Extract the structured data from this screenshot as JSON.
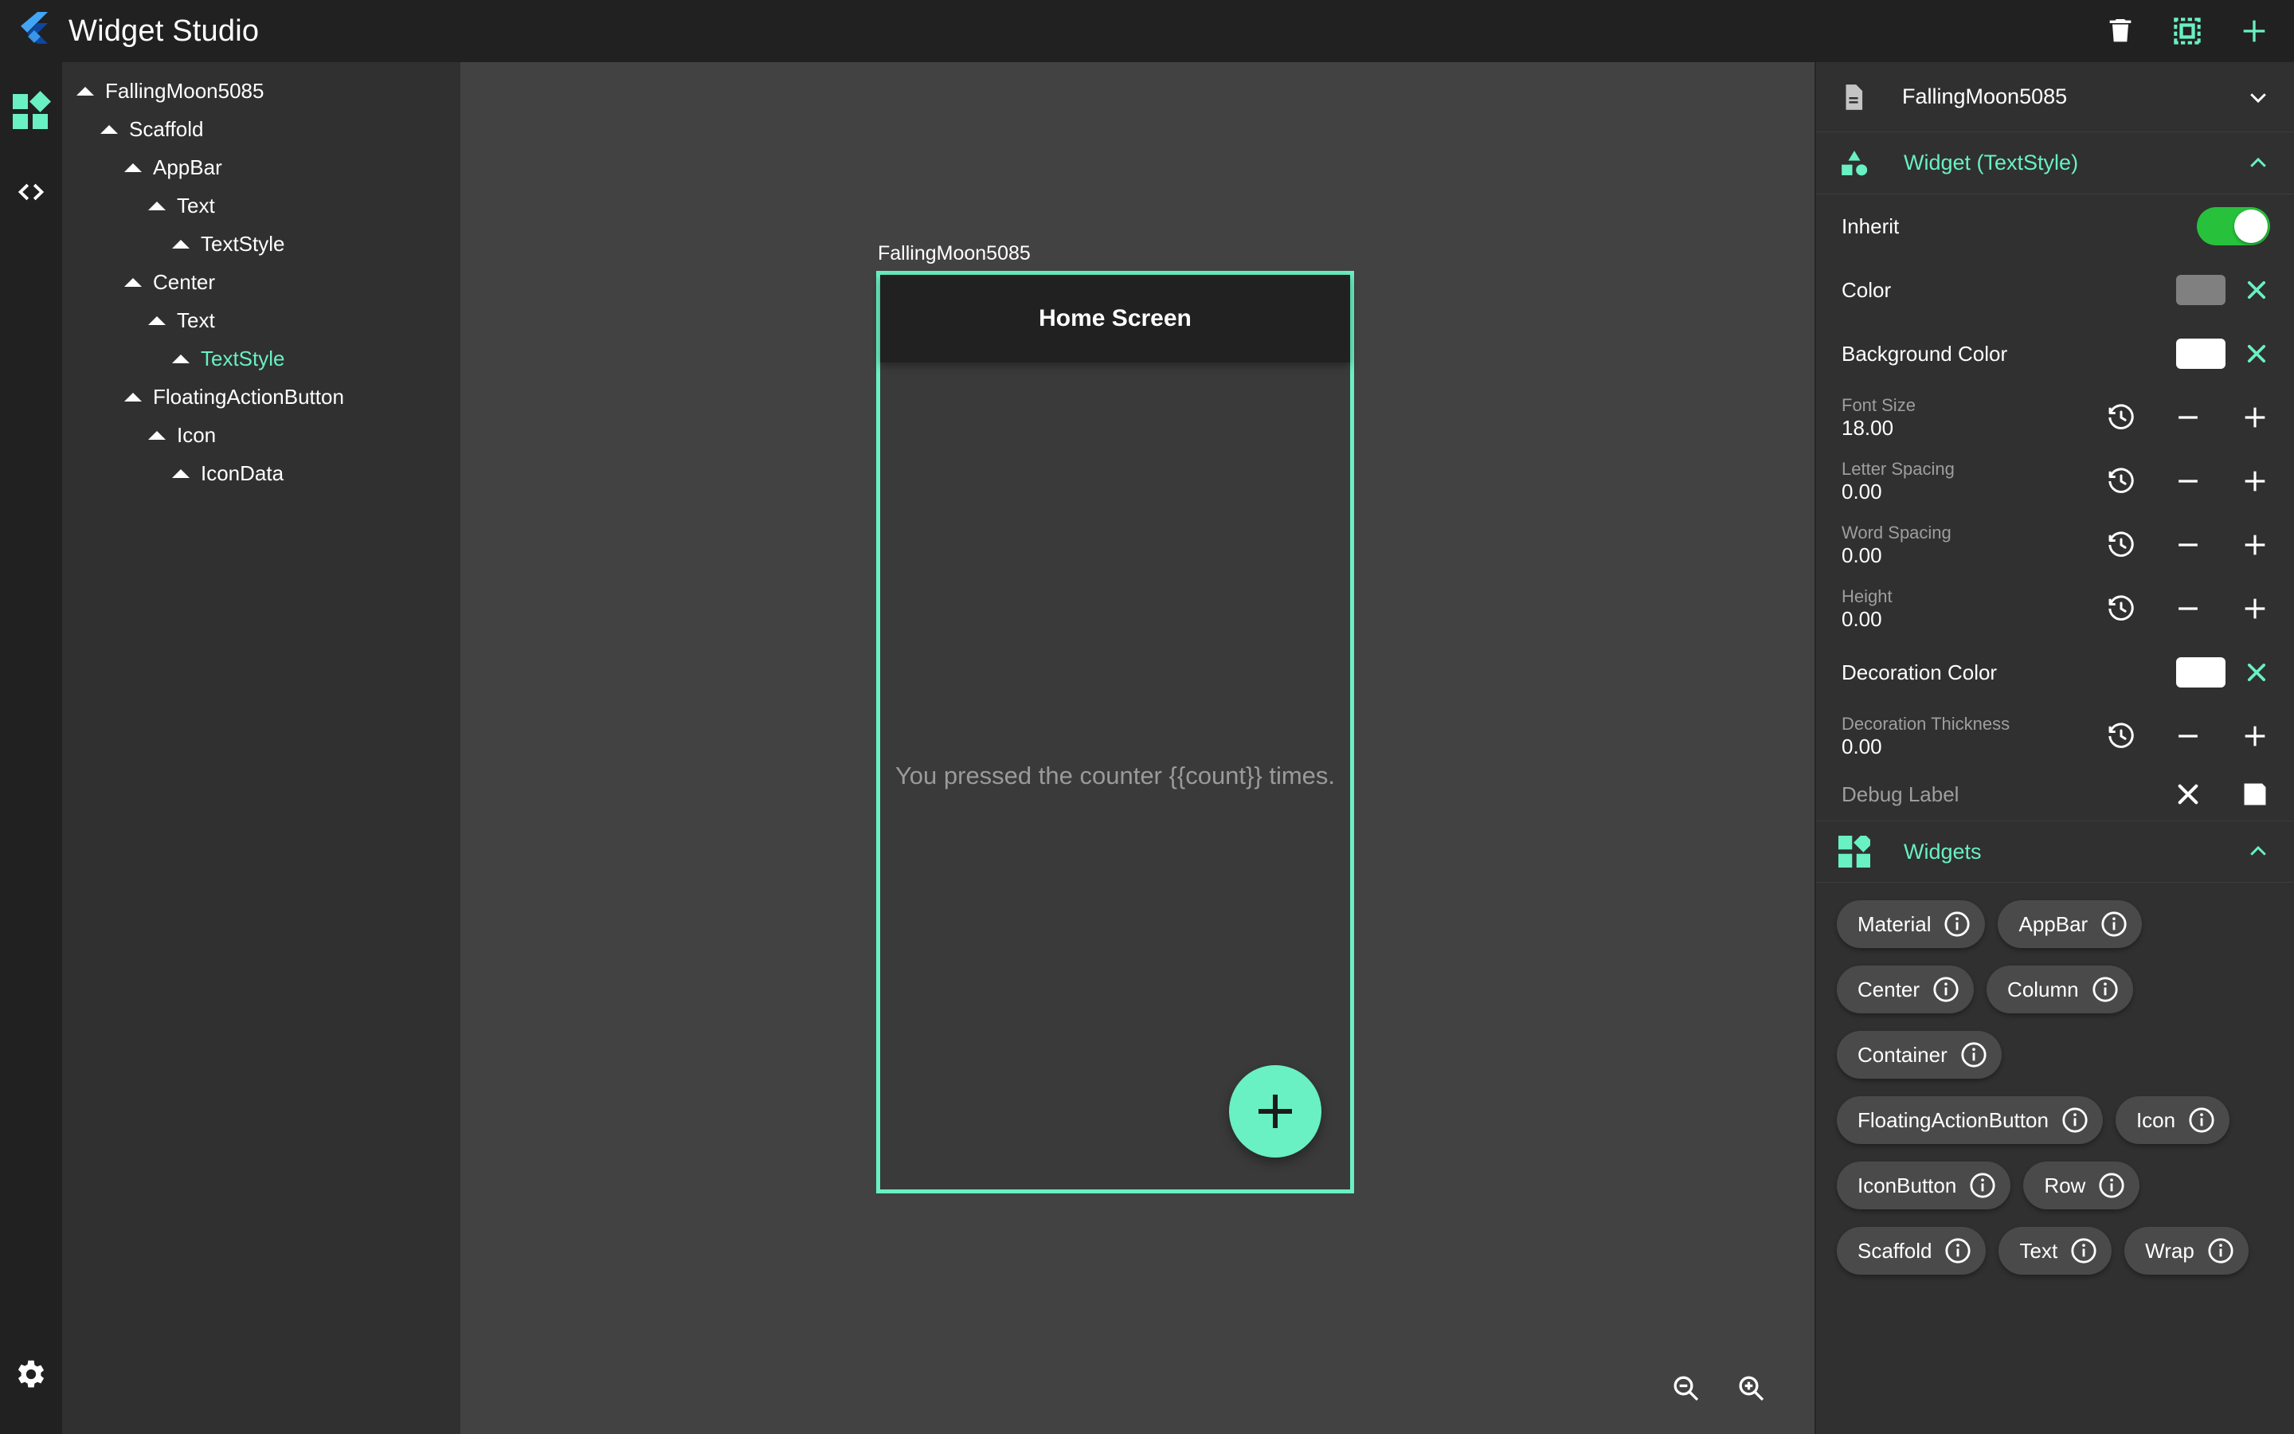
{
  "app": {
    "title": "Widget Studio",
    "logo_icon": "flutter-logo"
  },
  "titlebar_actions": [
    {
      "name": "delete-button",
      "icon": "trash-icon",
      "color": "#ffffff"
    },
    {
      "name": "select-widget-button",
      "icon": "dashed-selection-icon",
      "color": "#69F0C3"
    },
    {
      "name": "add-widget-button",
      "icon": "plus-icon",
      "color": "#69F0C3"
    }
  ],
  "rail": {
    "widgets_icon": "widgets-icon",
    "code_icon": "code-brackets-icon",
    "settings_icon": "gear-icon"
  },
  "tree": {
    "nodes": [
      {
        "label": "FallingMoon5085",
        "depth": 0,
        "selected": false
      },
      {
        "label": "Scaffold",
        "depth": 1,
        "selected": false
      },
      {
        "label": "AppBar",
        "depth": 2,
        "selected": false
      },
      {
        "label": "Text",
        "depth": 3,
        "selected": false
      },
      {
        "label": "TextStyle",
        "depth": 4,
        "selected": false
      },
      {
        "label": "Center",
        "depth": 2,
        "selected": false
      },
      {
        "label": "Text",
        "depth": 3,
        "selected": false
      },
      {
        "label": "TextStyle",
        "depth": 4,
        "selected": true
      },
      {
        "label": "FloatingActionButton",
        "depth": 2,
        "selected": false
      },
      {
        "label": "Icon",
        "depth": 3,
        "selected": false
      },
      {
        "label": "IconData",
        "depth": 4,
        "selected": false
      }
    ]
  },
  "canvas": {
    "preview_label": "FallingMoon5085",
    "selection_color": "#69F0C3",
    "device": {
      "appbar_title": "Home Screen",
      "center_text": "You pressed the counter {{count}} times.",
      "fab_icon": "plus-icon",
      "fab_color": "#69F0C3"
    },
    "zoom_out_icon": "zoom-out-icon",
    "zoom_in_icon": "zoom-in-icon"
  },
  "properties": {
    "header": {
      "icon": "document-icon",
      "title": "FallingMoon5085",
      "chevron": "chevron-down-icon"
    },
    "widget_section": {
      "icon": "shapes-icon",
      "title": "Widget (TextStyle)",
      "chevron": "chevron-up-icon",
      "rows": [
        {
          "kind": "toggle",
          "label": "Inherit",
          "value": "on",
          "accent": "#27C13C"
        },
        {
          "kind": "color",
          "label": "Color",
          "swatch": "#808080",
          "clear": "clear-icon"
        },
        {
          "kind": "color",
          "label": "Background Color",
          "swatch": "#ffffff",
          "clear": "clear-icon"
        },
        {
          "kind": "number",
          "label": "Font Size",
          "value": "18.00"
        },
        {
          "kind": "number",
          "label": "Letter Spacing",
          "value": "0.00"
        },
        {
          "kind": "number",
          "label": "Word Spacing",
          "value": "0.00"
        },
        {
          "kind": "number",
          "label": "Height",
          "value": "0.00"
        },
        {
          "kind": "color",
          "label": "Decoration Color",
          "swatch": "#ffffff",
          "clear": "clear-icon"
        },
        {
          "kind": "number",
          "label": "Decoration Thickness",
          "value": "0.00"
        },
        {
          "kind": "text",
          "label": "Debug Label",
          "value": ""
        }
      ]
    },
    "widgets_section": {
      "icon": "widgets-icon",
      "title": "Widgets",
      "chevron": "chevron-up-icon",
      "chips": [
        "Material",
        "AppBar",
        "Center",
        "Column",
        "Container",
        "FloatingActionButton",
        "Icon",
        "IconButton",
        "Row",
        "Scaffold",
        "Text",
        "Wrap"
      ]
    }
  },
  "colors": {
    "accent": "#69F0C3",
    "titlebar_bg": "#212121",
    "panel_bg": "#303030",
    "canvas_bg": "#424242",
    "toggle_on": "#27C13C"
  }
}
